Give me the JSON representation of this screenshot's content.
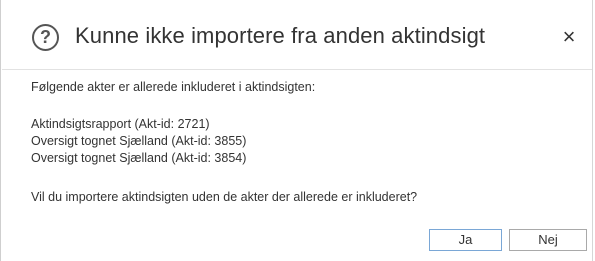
{
  "dialog": {
    "icon": "question-circle-icon",
    "title": "Kunne ikke importere fra anden aktindsigt",
    "close_glyph": "×",
    "intro": "Følgende akter er allerede inkluderet i aktindsigten:",
    "items": [
      "Aktindsigtsrapport (Akt-id: 2721)",
      "Oversigt tognet Sjælland (Akt-id: 3855)",
      "Oversigt tognet Sjælland (Akt-id: 3854)"
    ],
    "question": "Vil du importere aktindsigten uden de akter der allerede er inkluderet?",
    "buttons": {
      "yes": "Ja",
      "no": "Nej"
    }
  },
  "colors": {
    "primary_button_border": "#7aa7d6",
    "text": "#333333"
  }
}
